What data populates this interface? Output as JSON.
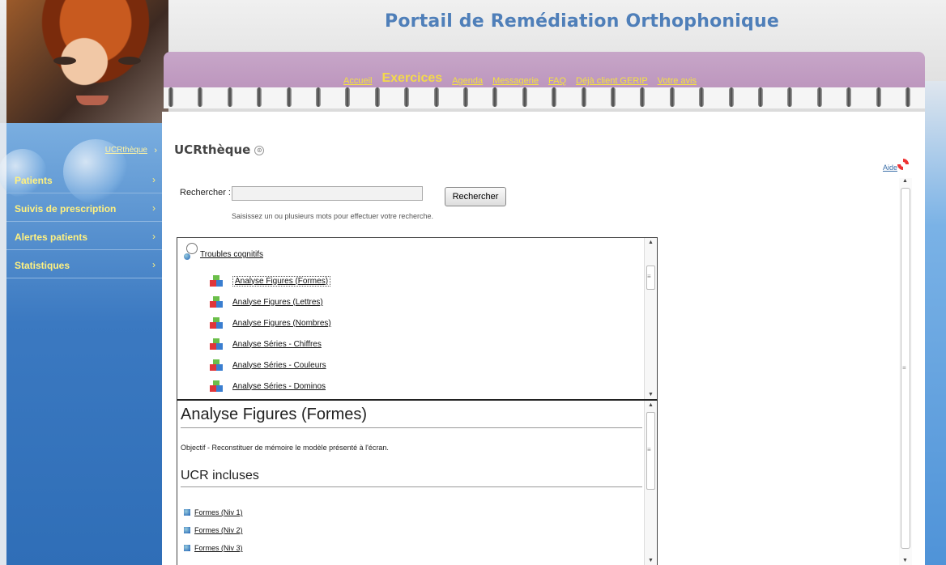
{
  "site": {
    "title": "Portail de Remédiation Orthophonique"
  },
  "top_nav": [
    {
      "label": "Accueil",
      "active": false
    },
    {
      "label": "Exercices",
      "active": true
    },
    {
      "label": "Agenda",
      "active": false
    },
    {
      "label": "Messagerie",
      "active": false
    },
    {
      "label": "FAQ",
      "active": false
    },
    {
      "label": "Déjà client GERIP",
      "active": false
    },
    {
      "label": "Votre avis",
      "active": false
    }
  ],
  "sidebar": {
    "breadcrumb": "UCRthèque",
    "breadcrumb_arrow": "›",
    "items": [
      {
        "label": "Patients",
        "arrow": "›"
      },
      {
        "label": "Suivis de prescription",
        "arrow": "›"
      },
      {
        "label": "Alertes patients",
        "arrow": "›"
      },
      {
        "label": "Statistiques",
        "arrow": "›"
      }
    ]
  },
  "main": {
    "title": "UCRthèque",
    "title_icon": "⊙",
    "help_label": "Aide",
    "search": {
      "label": "Rechercher :",
      "value": "",
      "button_label": "Rechercher",
      "hint": "Saisissez un ou plusieurs mots pour effectuer votre recherche."
    },
    "tree": {
      "root_label": "Troubles cognitifs",
      "items": [
        {
          "label": "Analyse Figures (Formes)",
          "selected": true
        },
        {
          "label": "Analyse Figures (Lettres)",
          "selected": false
        },
        {
          "label": "Analyse Figures (Nombres)",
          "selected": false
        },
        {
          "label": "Analyse Séries - Chiffres",
          "selected": false
        },
        {
          "label": "Analyse Séries - Couleurs",
          "selected": false
        },
        {
          "label": "Analyse Séries - Dominos",
          "selected": false
        }
      ]
    },
    "detail": {
      "title": "Analyse Figures (Formes)",
      "objective": "Objectif - Reconstituer de mémoire le modèle présenté à l'écran.",
      "included_title": "UCR incluses",
      "included": [
        "Formes (Niv 1)",
        "Formes (Niv 2)",
        "Formes (Niv 3)"
      ]
    }
  },
  "colors": {
    "nav_link": "#f4e240",
    "sidebar_text": "#fff180",
    "title_blue": "#4f7fb9",
    "sidebar_bg": "#3b79c1"
  }
}
